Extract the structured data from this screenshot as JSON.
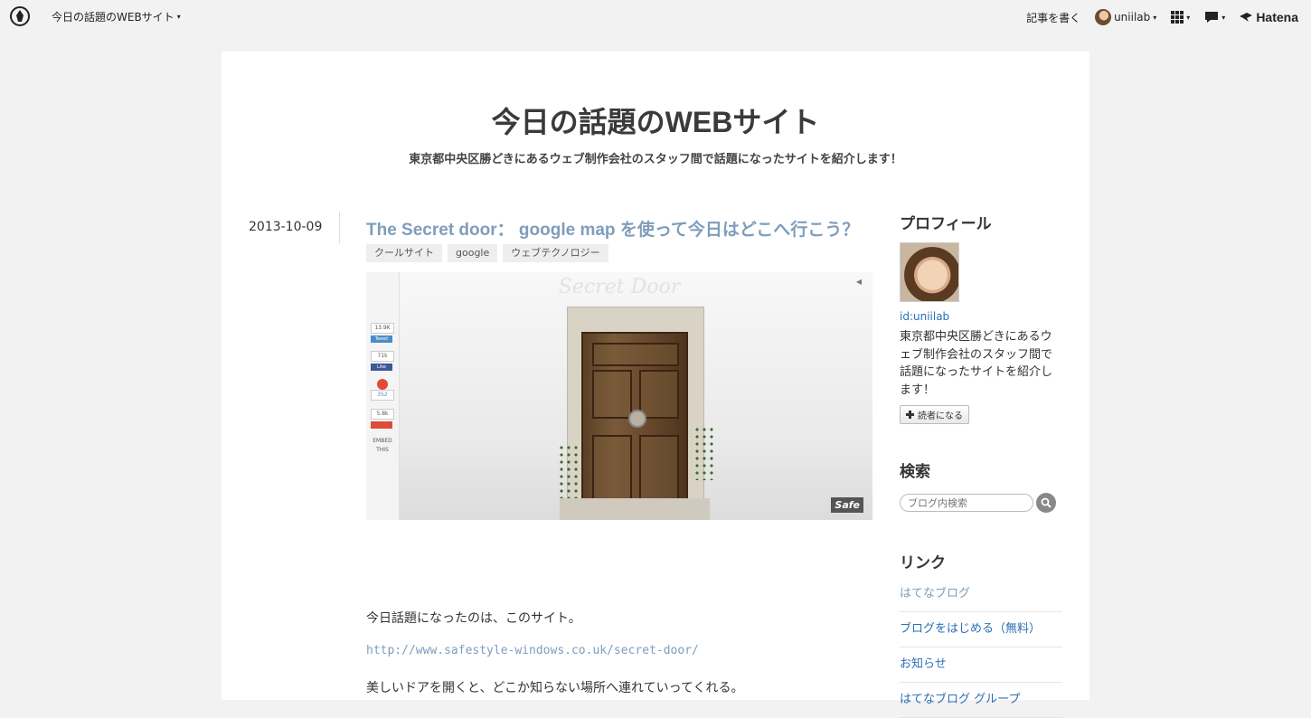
{
  "topbar": {
    "blog_name": "今日の話題のWEBサイト",
    "write_label": "記事を書く",
    "username": "uniilab",
    "brand": "Hatena"
  },
  "blog": {
    "title": "今日の話題のWEBサイト",
    "description": "東京都中央区勝どきにあるウェブ制作会社のスタッフ間で話題になったサイトを紹介します！"
  },
  "entry": {
    "date": "2013-10-09",
    "title": "The Secret door： google map を使って今日はどこへ行こう？",
    "categories": [
      "クールサイト",
      "google",
      "ウェブテクノロジー"
    ],
    "image": {
      "watermark": "Secret Door",
      "logo": "Safe",
      "social": {
        "tweets": "13.9K",
        "tweet_label": "Tweet",
        "likes": "71k",
        "like_label": "Like",
        "stumble": "352",
        "plus": "5.8k",
        "embed": "EMBED THIS"
      }
    },
    "paragraph1": "今日話題になったのは、このサイト。",
    "link": "http://www.safestyle-windows.co.uk/secret-door/",
    "paragraph2": "美しいドアを開くと、どこか知らない場所へ連れていってくれる。"
  },
  "sidebar": {
    "profile": {
      "title": "プロフィール",
      "id": "id:uniilab",
      "description": "東京都中央区勝どきにあるウェブ制作会社のスタッフ間で話題になったサイトを紹介します！",
      "subscribe": "読者になる"
    },
    "search": {
      "title": "検索",
      "placeholder": "ブログ内検索"
    },
    "links": {
      "title": "リンク",
      "items": [
        "はてなブログ",
        "ブログをはじめる（無料）",
        "お知らせ",
        "はてなブログ グループ"
      ]
    }
  }
}
